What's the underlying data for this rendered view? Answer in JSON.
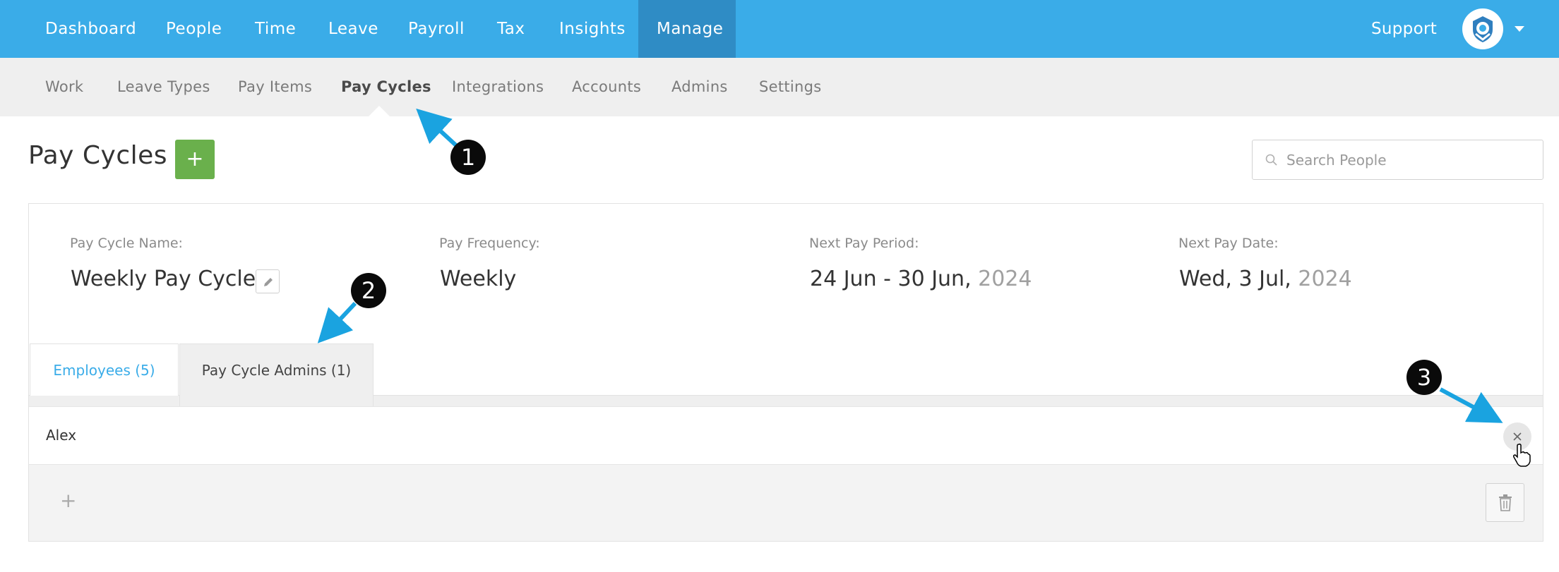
{
  "top_nav": {
    "items": [
      "Dashboard",
      "People",
      "Time",
      "Leave",
      "Payroll",
      "Tax",
      "Insights",
      "Manage"
    ],
    "active": "Manage",
    "support_label": "Support",
    "colors": {
      "bar": "#3aace8",
      "active": "#2f8cc5"
    }
  },
  "sub_nav": {
    "items": [
      "Work",
      "Leave Types",
      "Pay Items",
      "Pay Cycles",
      "Integrations",
      "Accounts",
      "Admins",
      "Settings"
    ],
    "active": "Pay Cycles"
  },
  "page": {
    "title": "Pay Cycles",
    "add_button_label": "+",
    "search_placeholder": "Search People"
  },
  "pay_cycle": {
    "name_label": "Pay Cycle Name:",
    "name": "Weekly Pay Cycle",
    "frequency_label": "Pay Frequency:",
    "frequency": "Weekly",
    "next_period_label": "Next Pay Period:",
    "next_period": "24 Jun - 30 Jun,",
    "next_period_year": "2024",
    "next_date_label": "Next Pay Date:",
    "next_date": "Wed, 3 Jul,",
    "next_date_year": "2024"
  },
  "tabs": {
    "employees": "Employees (5)",
    "admins": "Pay Cycle Admins (1)",
    "active": "Pay Cycle Admins (1)"
  },
  "admins": {
    "rows": [
      {
        "name": "Alex"
      }
    ],
    "add_label": "+"
  },
  "annotations": {
    "callout_1": "1",
    "callout_2": "2",
    "callout_3": "3",
    "arrow_color": "#1aa3e0"
  },
  "icons": {
    "avatar": "logo-avatar-icon",
    "search": "search-icon",
    "edit": "pencil-icon",
    "remove": "close-icon",
    "delete": "trash-icon",
    "cursor": "hand-pointer-icon"
  }
}
